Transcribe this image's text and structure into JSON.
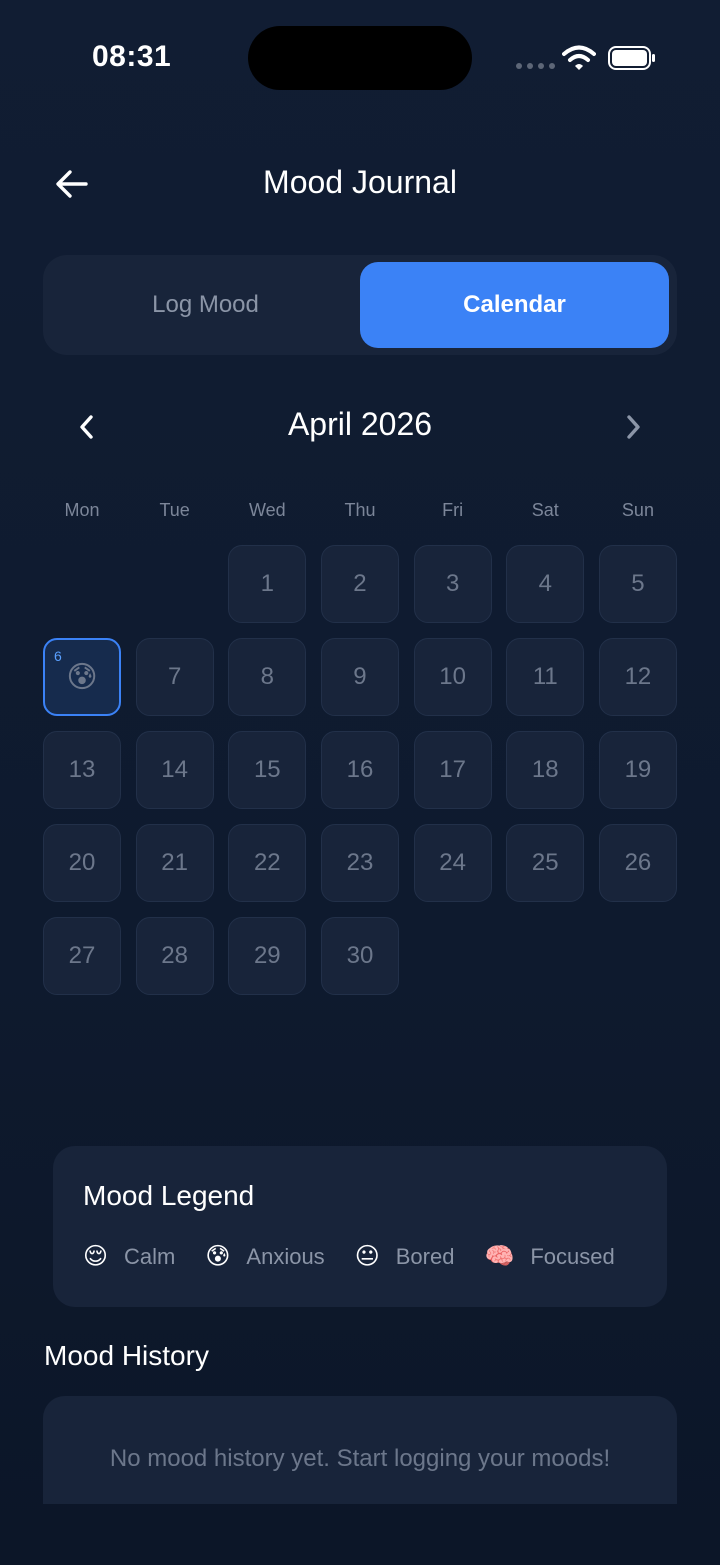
{
  "status_bar": {
    "time": "08:31"
  },
  "header": {
    "title": "Mood Journal",
    "back_icon": "arrow-left-icon"
  },
  "tabs": [
    {
      "label": "Log Mood",
      "active": false
    },
    {
      "label": "Calendar",
      "active": true
    }
  ],
  "calendar": {
    "month_label": "April 2026",
    "weekdays": [
      "Mon",
      "Tue",
      "Wed",
      "Thu",
      "Fri",
      "Sat",
      "Sun"
    ],
    "leading_blank_days": 2,
    "days": [
      "1",
      "2",
      "3",
      "4",
      "5",
      "6",
      "7",
      "8",
      "9",
      "10",
      "11",
      "12",
      "13",
      "14",
      "15",
      "16",
      "17",
      "18",
      "19",
      "20",
      "21",
      "22",
      "23",
      "24",
      "25",
      "26",
      "27",
      "28",
      "29",
      "30"
    ],
    "selected_day": "6",
    "selected_day_emoji": "😰"
  },
  "legend": {
    "title": "Mood Legend",
    "items": [
      {
        "emoji": "😌",
        "label": "Calm"
      },
      {
        "emoji": "😰",
        "label": "Anxious"
      },
      {
        "emoji": "😐",
        "label": "Bored"
      },
      {
        "emoji": "🧠",
        "label": "Focused"
      }
    ]
  },
  "history": {
    "title": "Mood History",
    "empty_text": "No mood history yet. Start logging your moods!"
  },
  "colors": {
    "accent": "#3b82f6",
    "background": "#0e1a2e",
    "card": "#18243a"
  }
}
